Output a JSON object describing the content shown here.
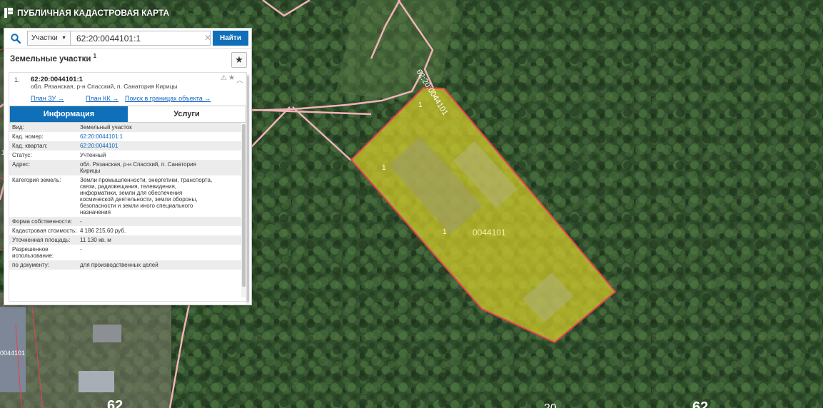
{
  "app": {
    "title": "ПУБЛИЧНАЯ КАДАСТРОВАЯ КАРТА"
  },
  "search": {
    "type_label": "Участки",
    "query": "62:20:0044101:1",
    "find_label": "Найти"
  },
  "results": {
    "header": "Земельные участки",
    "count": "1",
    "item": {
      "number": "1.",
      "cad_number": "62:20:0044101:1",
      "address": "обл. Рязанская, р-н Спасский, п. Санатория Кирицы",
      "links": [
        "План ЗУ →",
        "План КК →",
        "Поиск в границах объекта →"
      ]
    },
    "tabs": [
      "Информация",
      "Услуги"
    ],
    "properties": [
      {
        "key": "Вид:",
        "value": "Земельный участок"
      },
      {
        "key": "Кад. номер:",
        "value": "62:20:0044101:1"
      },
      {
        "key": "Кад. квартал:",
        "value": "62:20:0044101"
      },
      {
        "key": "Статус:",
        "value": "Учтенный"
      },
      {
        "key": "Адрес:",
        "value": "обл. Рязанская, р-н Спасский, п. Санатория Кирицы"
      },
      {
        "key": "Категория земель:",
        "value": "Земли промышленности, энергетики, транспорта, связи, радиовещания, телевидения, информатики, земли для обеспечения космической деятельности, земли обороны, безопасности и земли иного специального назначения"
      },
      {
        "key": "Форма собственности:",
        "value": "-"
      },
      {
        "key": "Кадастровая стоимость:",
        "value": "4 186 215,60 руб."
      },
      {
        "key": "Уточненная площадь:",
        "value": "11 130 кв. м"
      },
      {
        "key": "Разрешенное использование:",
        "value": "-"
      },
      {
        "key": "по документу:",
        "value": "для производственных целей"
      }
    ]
  },
  "map": {
    "parcel_label": "0044101",
    "parcel_marks": [
      "1",
      "1",
      "1"
    ],
    "road_label": "62:20:0044101",
    "edge_labels": [
      "14",
      "0044101",
      "62",
      "20",
      "62"
    ],
    "colors": {
      "parcel_fill": "#d4cc2a",
      "parcel_border": "#e8414f",
      "boundary": "#f1b3b8",
      "accent": "#0f6fb8"
    }
  }
}
